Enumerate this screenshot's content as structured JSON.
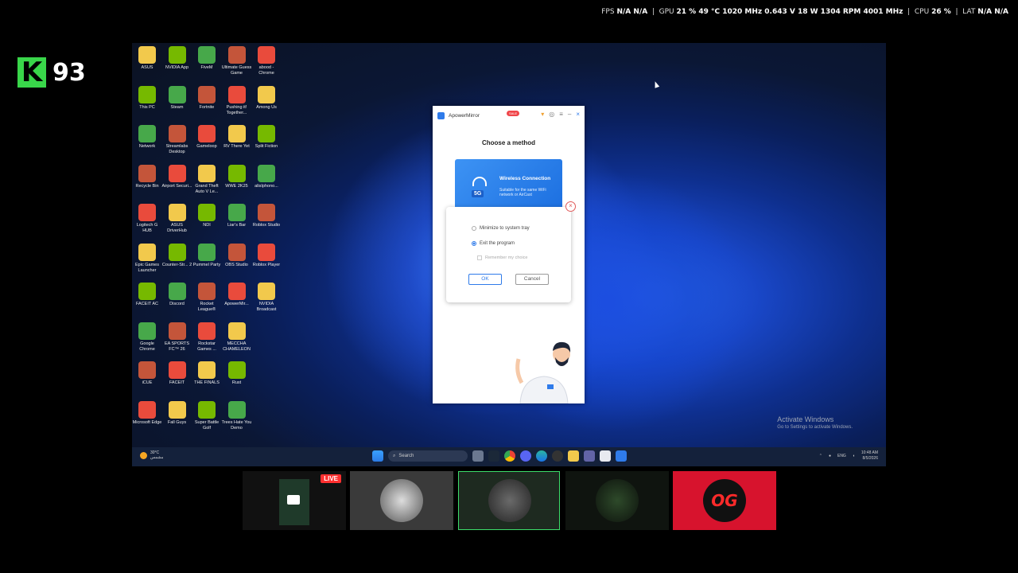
{
  "hud": {
    "fps_label": "FPS",
    "fps_values": "N/A  N/A",
    "gpu_label": "GPU",
    "gpu_values": "21 %  49 °C  1020 MHz  0.643 V  18 W  1304 RPM  4001 MHz",
    "cpu_label": "CPU",
    "cpu_value": "26 %",
    "lat_label": "LAT",
    "lat_values": "N/A  N/A"
  },
  "badge": {
    "letter": "K",
    "number": "93"
  },
  "desktop_icons": [
    [
      "ASUS",
      "NVIDIA App",
      "FiveM",
      "Ultimate Guess Game",
      "abood - Chrome"
    ],
    [
      "This PC",
      "Steam",
      "Fortnite",
      "Pushing it! Together...",
      "Among Us"
    ],
    [
      "Network",
      "Streamlabs Desktop",
      "Gameloop",
      "RV There Yet",
      "Split Fiction"
    ],
    [
      "Recycle Bin",
      "Airport Securi...",
      "Grand Theft Auto V Le...",
      "WWE 2K25",
      "alisIphono..."
    ],
    [
      "Logitech G HUB",
      "ASUS DriverHub",
      "NDI",
      "Liar's Bar",
      "Roblox Studio"
    ],
    [
      "Epic Games Launcher",
      "Counter-Str... 2",
      "Pummel Party",
      "OBS Studio",
      "Roblox Player"
    ],
    [
      "FACEIT AC",
      "Discord",
      "Rocket League®",
      "ApowerMir...",
      "NVIDIA Broadcast"
    ],
    [
      "Google Chrome",
      "EA SPORTS FC™ 26",
      "Rockstar Games ...",
      "MECCHA CHAMELEON",
      ""
    ],
    [
      "iCUE",
      "FACEIT",
      "THE FINALS",
      "Rust",
      ""
    ],
    [
      "Microsoft Edge",
      "Fall Guys",
      "Super Battle Golf",
      "Trees Hate You Demo",
      ""
    ]
  ],
  "icon_colors": [
    "#f2c94c",
    "#76b900",
    "#47a84a",
    "#c4553a",
    "#e94b3c"
  ],
  "activation": {
    "title": "Activate Windows",
    "subtitle": "Go to Settings to activate Windows."
  },
  "taskbar": {
    "weather_temp": "30°C",
    "weather_text": "مشمس",
    "search_placeholder": "Search",
    "lang": "ENG",
    "time": "10:48 AM",
    "date": "8/5/2026"
  },
  "app": {
    "title": "ApowerMirror",
    "sale": "SALE",
    "heading": "Choose a method",
    "card_title": "Wireless Connection",
    "card_desc": "Suitable for the same WiFi network or AirCast",
    "card_badge": "5G",
    "accent": "#2f7bea"
  },
  "dialog": {
    "option1": "Minimize to system tray",
    "option2": "Exit the program",
    "remember": "Remember my choice",
    "ok": "OK",
    "cancel": "Cancel",
    "selected": "Exit the program"
  },
  "stream": {
    "live_label": "LIVE",
    "brand": "OG"
  }
}
